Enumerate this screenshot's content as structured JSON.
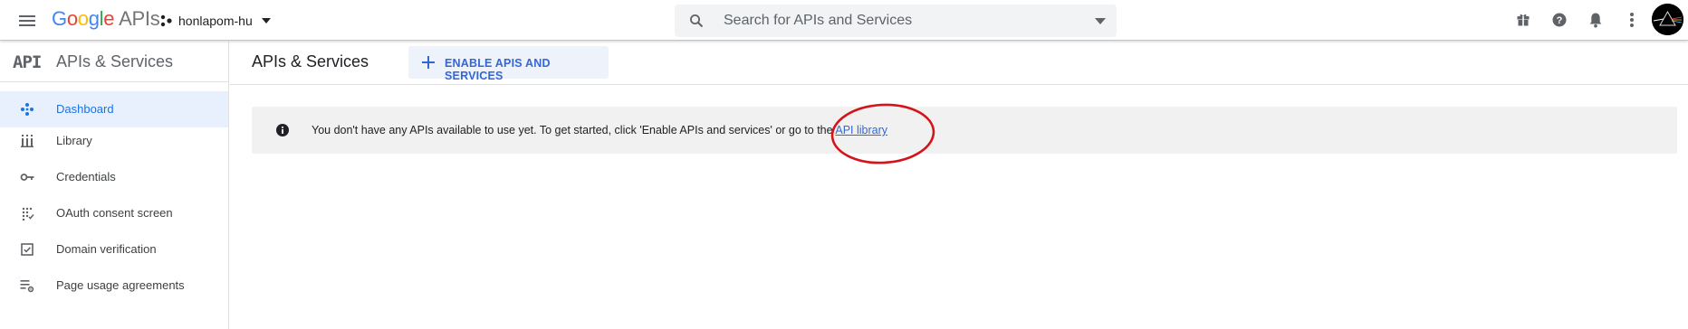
{
  "topbar": {
    "logo_google": "Google",
    "logo_apis": "APIs",
    "project_name": "honlapom-hu",
    "search_placeholder": "Search for APIs and Services"
  },
  "sidebar": {
    "header_logo": "API",
    "header_title": "APIs & Services",
    "items": [
      {
        "label": "Dashboard",
        "icon": "dashboard-icon",
        "active": true
      },
      {
        "label": "Library",
        "icon": "library-icon"
      },
      {
        "label": "Credentials",
        "icon": "key-icon"
      },
      {
        "label": "OAuth consent screen",
        "icon": "oauth-consent-icon"
      },
      {
        "label": "Domain verification",
        "icon": "checkbox-icon"
      },
      {
        "label": "Page usage agreements",
        "icon": "settings-list-icon"
      }
    ]
  },
  "main": {
    "title": "APIs & Services",
    "enable_button_label": "ENABLE APIS AND SERVICES",
    "info_message": "You don't have any APIs available to use yet. To get started, click 'Enable APIs and services' or go to the ",
    "info_link": "API library"
  },
  "colors": {
    "accent": "#1a73e8",
    "link": "#3367d6",
    "annotation": "#d3141b",
    "active_bg": "#e8f0fe",
    "info_bg": "#f1f1f1"
  }
}
